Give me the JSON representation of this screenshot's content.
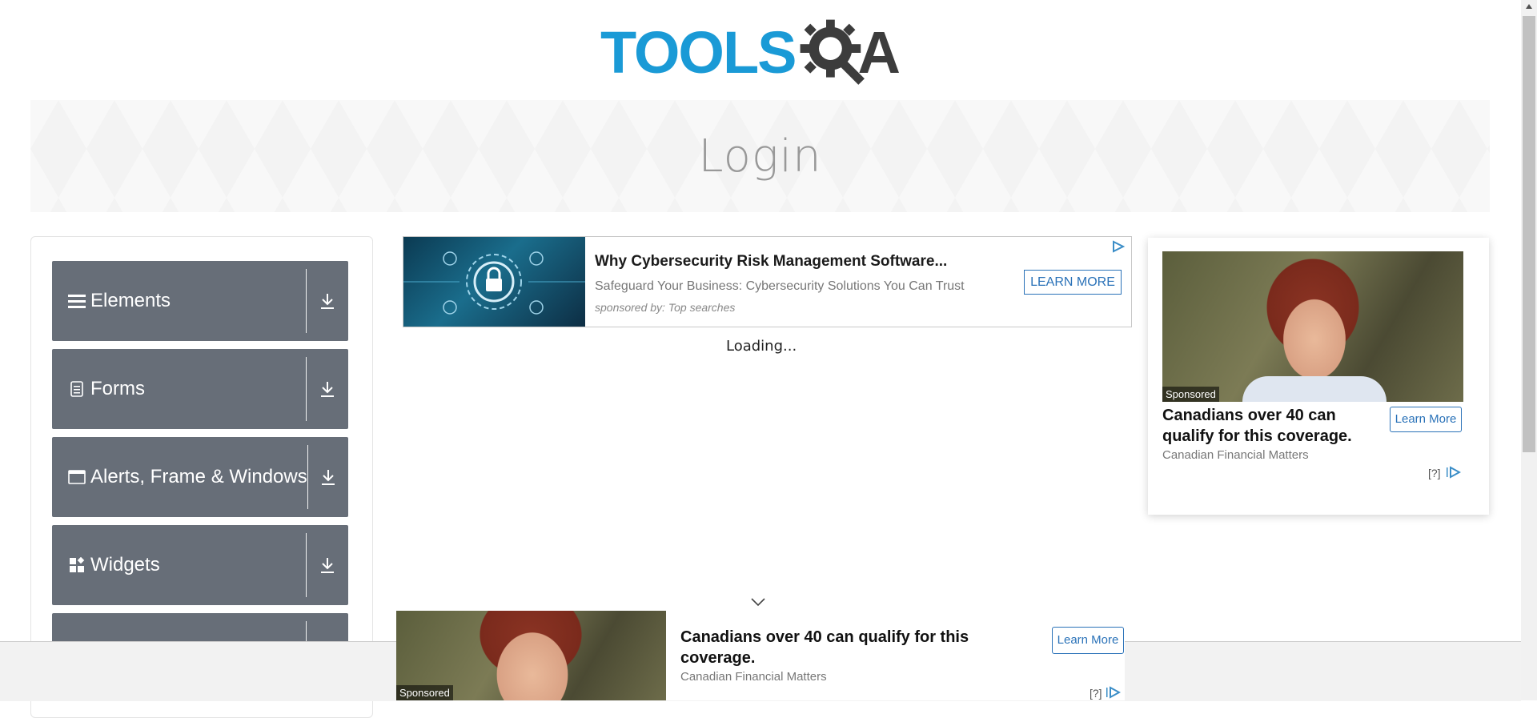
{
  "header": {
    "logo_text_primary": "TOOLS",
    "logo_text_secondary": "A",
    "logo_alt": "TOOLSQA"
  },
  "banner": {
    "title": "Login"
  },
  "sidebar": {
    "groups": [
      {
        "label": "Elements",
        "icon": "hamburger-icon"
      },
      {
        "label": "Forms",
        "icon": "document-icon"
      },
      {
        "label": "Alerts, Frame & Windows",
        "icon": "window-icon"
      },
      {
        "label": "Widgets",
        "icon": "widgets-icon"
      },
      {
        "label": "",
        "icon": ""
      }
    ]
  },
  "main": {
    "loading_text": "Loading..."
  },
  "ads": {
    "top": {
      "headline": "Why Cybersecurity Risk Management Software...",
      "subtext": "Safeguard Your Business: Cybersecurity Solutions You Can Trust",
      "sponsor": "sponsored by: Top searches",
      "cta": "LEARN MORE"
    },
    "right": {
      "tag": "Sponsored",
      "title": "Canadians over 40 can qualify for this coverage.",
      "cta": "Learn More",
      "source": "Canadian Financial Matters",
      "info": "[?]"
    },
    "bottom": {
      "tag": "Sponsored",
      "title": "Canadians over 40 can qualify for this coverage.",
      "cta": "Learn More",
      "source": "Canadian Financial Matters",
      "info": "[?]"
    }
  },
  "colors": {
    "brand_blue": "#1a9ad6",
    "menu_gray": "#676e78",
    "ad_link_blue": "#2a72b8"
  }
}
